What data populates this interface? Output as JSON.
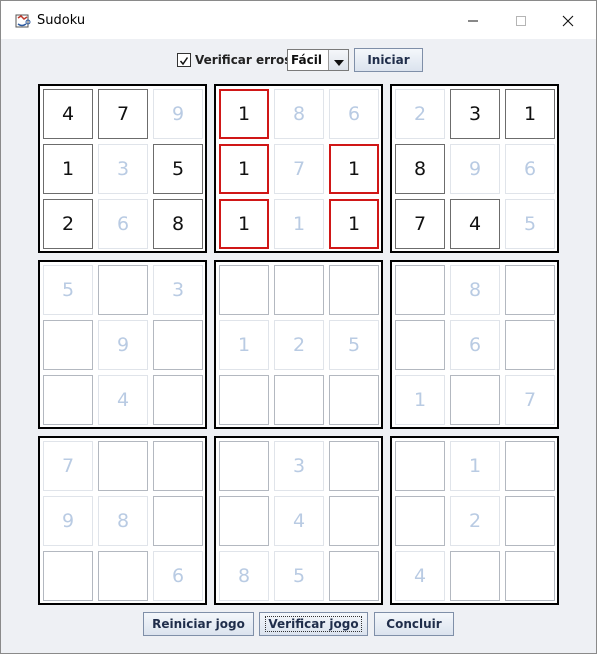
{
  "window": {
    "title": "Sudoku",
    "app_icon": "java-cup-icon"
  },
  "controls": {
    "check_errors_label": "Verificar erros",
    "check_errors_checked": true,
    "difficulty_selected": "Fácil",
    "start_label": "Iniciar"
  },
  "footer": {
    "restart_label": "Reiniciar jogo",
    "verify_label": "Verificar jogo",
    "finish_label": "Concluir"
  },
  "colors": {
    "given_digit": "#b9cbe3",
    "entered_digit": "#111111",
    "error_border": "#d01717"
  },
  "grid": [
    [
      "4",
      "7",
      "9",
      "1",
      "8",
      "6",
      "2",
      "3",
      "1"
    ],
    [
      "1",
      "3",
      "5",
      "1",
      "7",
      "1",
      "8",
      "9",
      "6"
    ],
    [
      "2",
      "6",
      "8",
      "1",
      "1",
      "1",
      "7",
      "4",
      "5"
    ],
    [
      "5",
      "",
      "3",
      "",
      "",
      "",
      "",
      "8",
      ""
    ],
    [
      "",
      "9",
      "",
      "1",
      "2",
      "5",
      "",
      "6",
      ""
    ],
    [
      "",
      "4",
      "",
      "",
      "",
      "",
      "1",
      "",
      "7"
    ],
    [
      "7",
      "",
      "",
      "",
      "3",
      "",
      "",
      "1",
      ""
    ],
    [
      "9",
      "8",
      "",
      "",
      "4",
      "",
      "",
      "2",
      ""
    ],
    [
      "",
      "",
      "6",
      "8",
      "5",
      "",
      "4",
      "",
      ""
    ]
  ],
  "cell_state": [
    [
      "filled",
      "filled",
      "given",
      "error",
      "given",
      "given",
      "given",
      "filled",
      "filled"
    ],
    [
      "filled",
      "given",
      "filled",
      "error",
      "given",
      "error",
      "filled",
      "given",
      "given"
    ],
    [
      "filled",
      "given",
      "filled",
      "error",
      "given",
      "error",
      "filled",
      "filled",
      "given"
    ],
    [
      "given",
      "empty",
      "given",
      "empty",
      "empty",
      "empty",
      "empty",
      "given",
      "empty"
    ],
    [
      "empty",
      "given",
      "empty",
      "given",
      "given",
      "given",
      "empty",
      "given",
      "empty"
    ],
    [
      "empty",
      "given",
      "empty",
      "empty",
      "empty",
      "empty",
      "given",
      "empty",
      "given"
    ],
    [
      "given",
      "empty",
      "empty",
      "empty",
      "given",
      "empty",
      "empty",
      "given",
      "empty"
    ],
    [
      "given",
      "given",
      "empty",
      "empty",
      "given",
      "empty",
      "empty",
      "given",
      "empty"
    ],
    [
      "empty",
      "empty",
      "given",
      "given",
      "given",
      "empty",
      "given",
      "empty",
      "empty"
    ]
  ]
}
